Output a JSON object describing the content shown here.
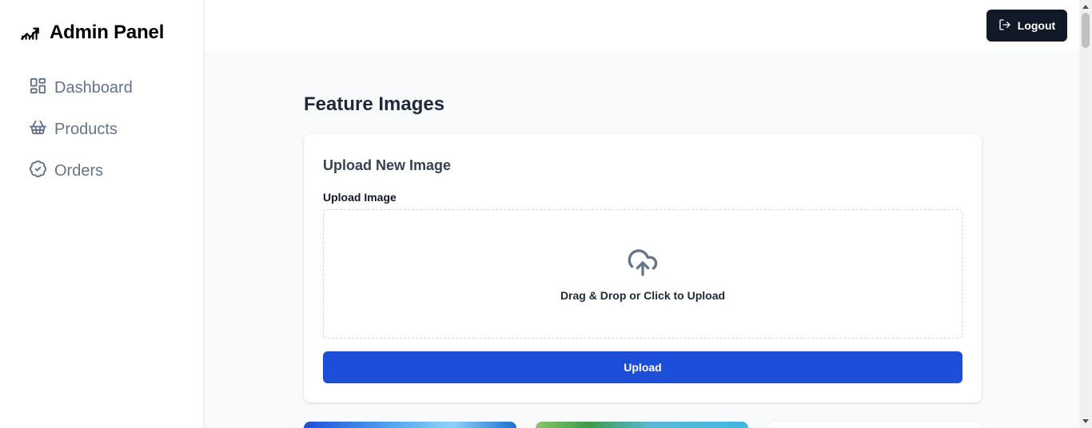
{
  "sidebar": {
    "brand_title": "Admin Panel",
    "brand_icon": "chart-line-icon",
    "items": [
      {
        "label": "Dashboard",
        "icon": "layout-dashboard-icon"
      },
      {
        "label": "Products",
        "icon": "shopping-basket-icon"
      },
      {
        "label": "Orders",
        "icon": "badge-check-icon"
      }
    ]
  },
  "header": {
    "logout_label": "Logout",
    "logout_icon": "log-out-icon"
  },
  "main": {
    "page_title": "Feature Images",
    "upload_card": {
      "title": "Upload New Image",
      "field_label": "Upload Image",
      "dropzone_text": "Drag & Drop or Click to Upload",
      "dropzone_icon": "cloud-upload-icon",
      "upload_button_label": "Upload"
    }
  },
  "colors": {
    "primary_button": "#1d4ed8",
    "logout_button": "#111827",
    "nav_text": "#64748b",
    "main_background": "#f8fafc"
  }
}
